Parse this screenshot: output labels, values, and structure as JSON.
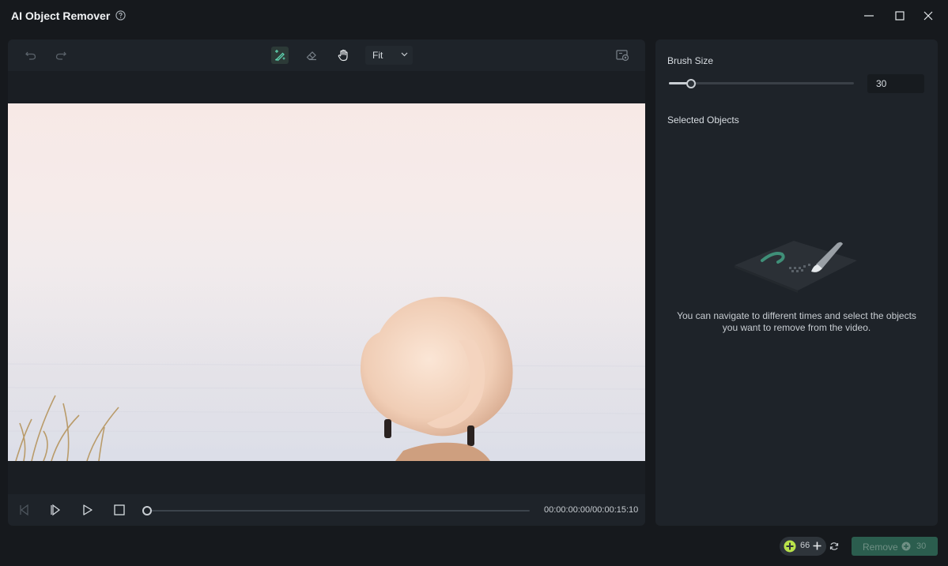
{
  "window": {
    "title": "AI Object Remover"
  },
  "toolbar": {
    "zoom_value": "Fit",
    "active_tool": "brush"
  },
  "player": {
    "timecode": "00:00:00:00/00:00:15:10",
    "progress": 0
  },
  "panel": {
    "brush_size_label": "Brush Size",
    "brush_size_value": "30",
    "brush_size_fraction": 0.12,
    "selected_objects_label": "Selected Objects",
    "empty_line1": "You can navigate to different times and select the objects",
    "empty_line2": "you want to remove from the video."
  },
  "footer": {
    "credits": "66",
    "remove_label": "Remove",
    "remove_cost": "30"
  },
  "colors": {
    "background": "#16191d",
    "panel": "#1e2329",
    "accent": "#2b5d4e",
    "brush_active": "#5fd4b0"
  }
}
